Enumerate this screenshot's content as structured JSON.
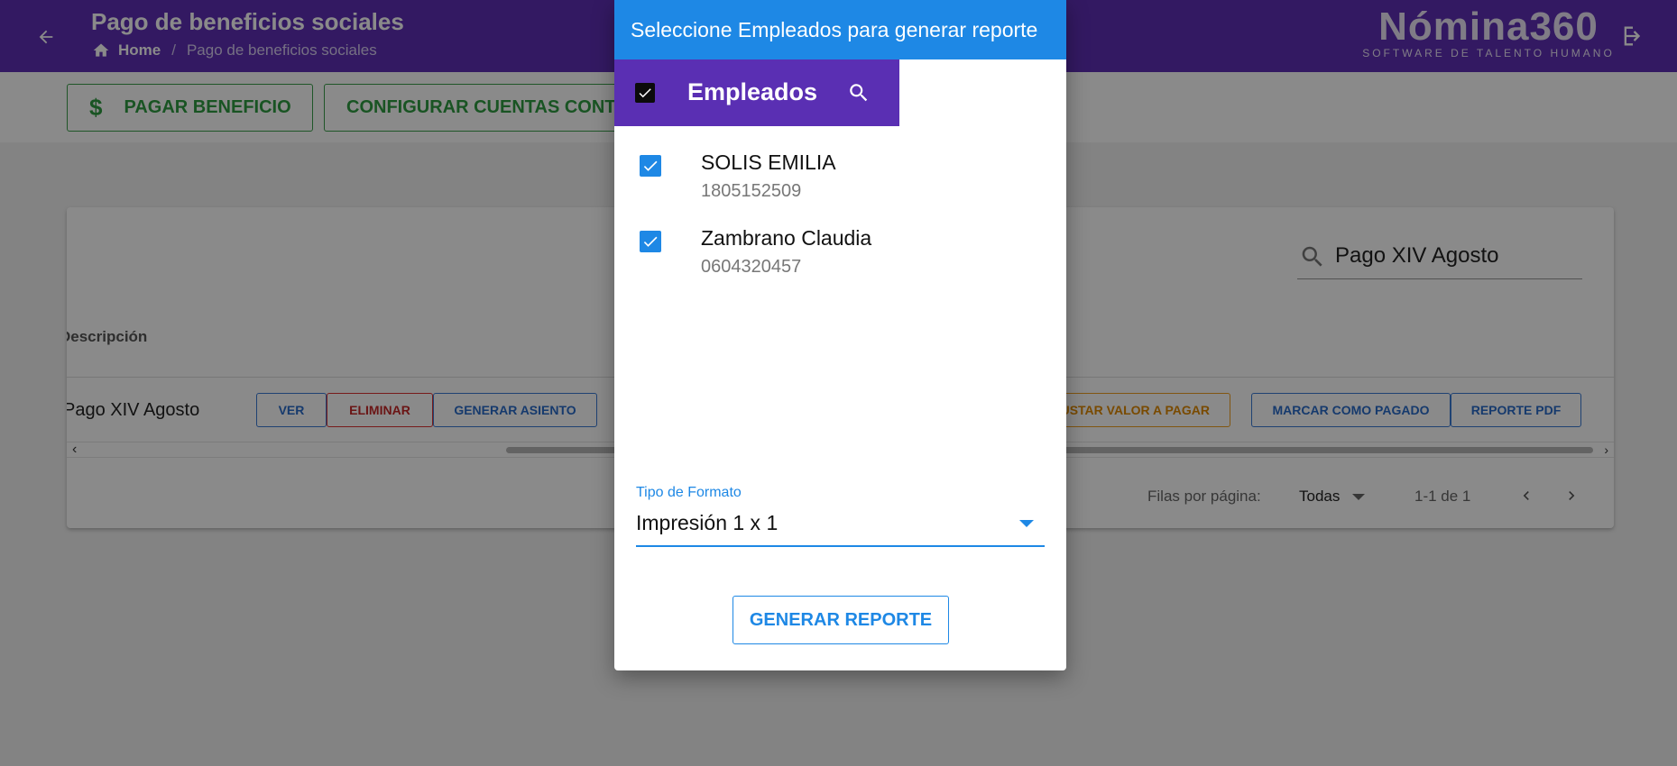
{
  "header": {
    "title": "Pago de beneficios sociales",
    "breadcrumb": {
      "home": "Home",
      "current": "Pago de beneficios sociales"
    },
    "logo": {
      "main": "Nómina360",
      "sub": "SOFTWARE DE TALENTO HUMANO"
    }
  },
  "toolbar": {
    "pay_label": "PAGAR BENEFICIO",
    "config_label": "CONFIGURAR CUENTAS CONTA"
  },
  "table": {
    "search_value": "Pago XIV Agosto",
    "column_header": "Descripción",
    "row": {
      "description": "Pago XIV Agosto",
      "actions": {
        "ver": "VER",
        "eliminar": "ELIMINAR",
        "generar_asiento": "GENERAR ASIENTO",
        "ajustar": "AJUSTAR VALOR A PAGAR",
        "marcar": "MARCAR COMO PAGADO",
        "reporte_pdf": "REPORTE PDF"
      }
    },
    "pagination": {
      "rows_label": "Filas por página:",
      "rows_value": "Todas",
      "range": "1-1 de 1"
    }
  },
  "dialog": {
    "title": "Seleccione Empleados para generar reporte",
    "employees_label": "Empleados",
    "employees": [
      {
        "name": "SOLIS EMILIA",
        "id": "1805152509",
        "checked": true
      },
      {
        "name": "Zambrano Claudia",
        "id": "0604320457",
        "checked": true
      }
    ],
    "format_label": "Tipo de Formato",
    "format_value": "Impresión 1 x 1",
    "generate_label": "GENERAR REPORTE"
  },
  "colors": {
    "primary_purple": "#5f2fb5",
    "dialog_header_blue": "#1e88e5",
    "success_green": "#2f9c41",
    "danger_red": "#c62828",
    "warning_orange": "#e08a00"
  }
}
